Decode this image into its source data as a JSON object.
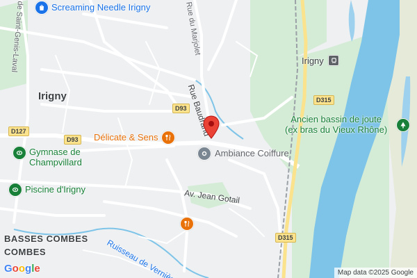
{
  "map": {
    "labels": {
      "town": "Irigny",
      "district_basses": "BASSES COMBES",
      "district_combes": "COMBES",
      "street_saint_genis": "de Saint-Genis-Laval",
      "street_marjolet": "Rue du Marjolet",
      "street_baudrand": "Rue Baudrand",
      "street_gotail": "Av. Jean Gotail",
      "stream_verniere": "Ruisseau de Vernière",
      "station": "Irigny",
      "water_basin": "Ancien bassin de joute\n(ex bras du Vieux Rhône)"
    },
    "routes": {
      "d93a": "D93",
      "d93b": "D93",
      "d127": "D127",
      "d315a": "D315",
      "d315b": "D315"
    },
    "pois": {
      "screaming_needle": "Screaming Needle Irigny",
      "delicate_sens": "Délicate & Sens",
      "ambiance_coiffure": "Ambiance Coiffure",
      "gymnase": "Gymnase de\nChampvillard",
      "piscine": "Piscine d'Irigny"
    },
    "colors": {
      "background": "#eef0f2",
      "park": "#d4ecd6",
      "water": "#7ec4e8",
      "road": "#ffffff",
      "highway": "#fbe28c",
      "marker": "#ea4335",
      "poi_blue": "#1a73e8",
      "poi_green": "#188038",
      "poi_orange": "#e8710a"
    },
    "icons": {
      "selected": "red-location-pin-icon",
      "shop": "shopping-bag-icon",
      "restaurant": "fork-knife-icon",
      "sport": "stadium-icon",
      "pool": "stadium-icon",
      "salon": "hair-salon-icon",
      "station": "train-icon",
      "park": "tree-icon"
    },
    "attribution": "Map data ©2025 Google",
    "logo": "Google"
  }
}
